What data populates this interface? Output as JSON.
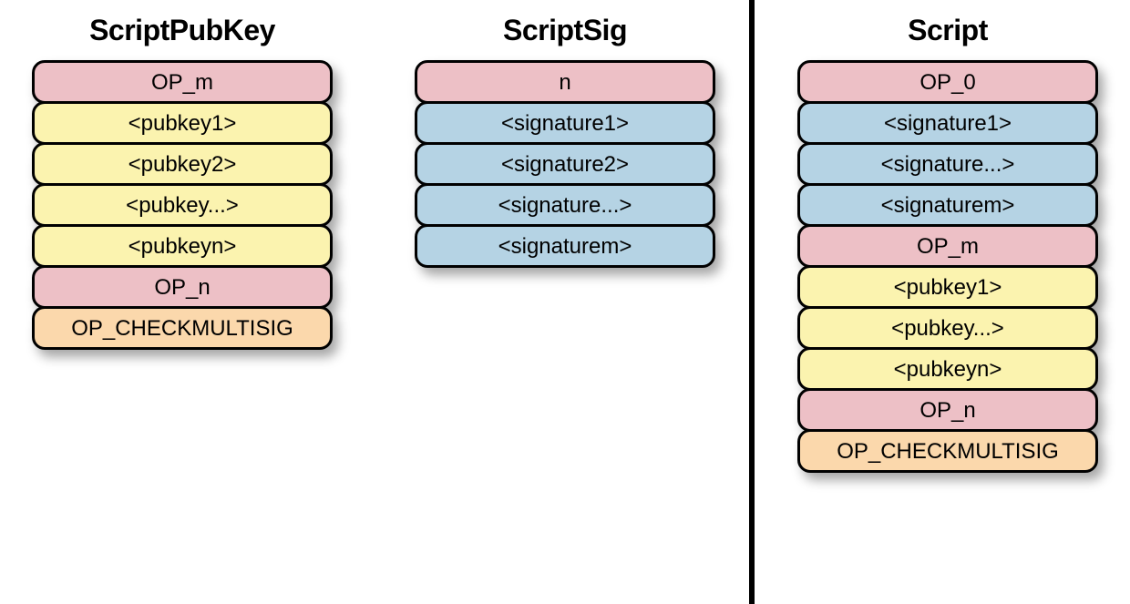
{
  "colors": {
    "pink": "#edc0c6",
    "yellow": "#fbf3af",
    "blue": "#b5d3e4",
    "orange": "#fbd8ac"
  },
  "columns": {
    "scriptPubKey": {
      "title": "ScriptPubKey",
      "items": [
        {
          "label": "OP_m",
          "c": "pink"
        },
        {
          "label": "<pubkey1>",
          "c": "yellow"
        },
        {
          "label": "<pubkey2>",
          "c": "yellow"
        },
        {
          "label": "<pubkey...>",
          "c": "yellow"
        },
        {
          "label": "<pubkeyn>",
          "c": "yellow"
        },
        {
          "label": "OP_n",
          "c": "pink"
        },
        {
          "label": "OP_CHECKMULTISIG",
          "c": "orange"
        }
      ]
    },
    "scriptSig": {
      "title": "ScriptSig",
      "items": [
        {
          "label": "n",
          "c": "pink"
        },
        {
          "label": "<signature1>",
          "c": "blue"
        },
        {
          "label": "<signature2>",
          "c": "blue"
        },
        {
          "label": "<signature...>",
          "c": "blue"
        },
        {
          "label": "<signaturem>",
          "c": "blue"
        }
      ]
    },
    "script": {
      "title": "Script",
      "items": [
        {
          "label": "OP_0",
          "c": "pink"
        },
        {
          "label": "<signature1>",
          "c": "blue"
        },
        {
          "label": "<signature...>",
          "c": "blue"
        },
        {
          "label": "<signaturem>",
          "c": "blue"
        },
        {
          "label": "OP_m",
          "c": "pink"
        },
        {
          "label": "<pubkey1>",
          "c": "yellow"
        },
        {
          "label": "<pubkey...>",
          "c": "yellow"
        },
        {
          "label": "<pubkeyn>",
          "c": "yellow"
        },
        {
          "label": "OP_n",
          "c": "pink"
        },
        {
          "label": "OP_CHECKMULTISIG",
          "c": "orange"
        }
      ]
    }
  }
}
